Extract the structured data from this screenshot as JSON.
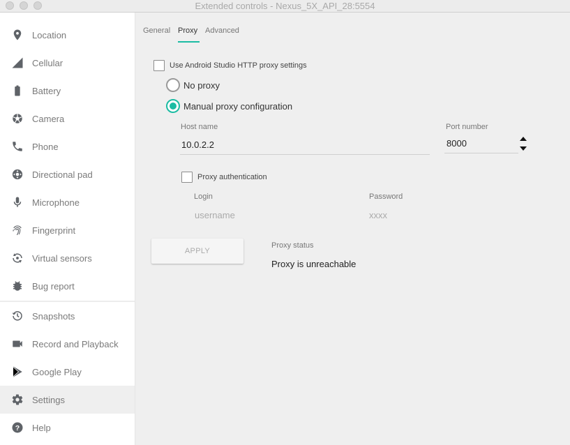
{
  "window": {
    "title": "Extended controls - Nexus_5X_API_28:5554"
  },
  "sidebar": {
    "items": [
      {
        "label": "Location",
        "icon": "location-pin-icon"
      },
      {
        "label": "Cellular",
        "icon": "cellular-signal-icon"
      },
      {
        "label": "Battery",
        "icon": "battery-icon"
      },
      {
        "label": "Camera",
        "icon": "camera-aperture-icon"
      },
      {
        "label": "Phone",
        "icon": "phone-icon"
      },
      {
        "label": "Directional pad",
        "icon": "dpad-icon"
      },
      {
        "label": "Microphone",
        "icon": "microphone-icon"
      },
      {
        "label": "Fingerprint",
        "icon": "fingerprint-icon"
      },
      {
        "label": "Virtual sensors",
        "icon": "virtual-sensors-icon"
      },
      {
        "label": "Bug report",
        "icon": "bug-icon"
      },
      {
        "label": "Snapshots",
        "icon": "snapshot-history-icon"
      },
      {
        "label": "Record and Playback",
        "icon": "video-camera-icon"
      },
      {
        "label": "Google Play",
        "icon": "play-store-icon"
      },
      {
        "label": "Settings",
        "icon": "gear-icon",
        "active": true
      },
      {
        "label": "Help",
        "icon": "help-icon"
      }
    ]
  },
  "tabs": {
    "general": "General",
    "proxy": "Proxy",
    "advanced": "Advanced",
    "active": "Proxy"
  },
  "proxy": {
    "use_studio_label": "Use Android Studio HTTP proxy settings",
    "use_studio_checked": false,
    "no_proxy_label": "No proxy",
    "manual_label": "Manual proxy configuration",
    "selected": "manual",
    "host_caption": "Host name",
    "host_value": "10.0.2.2",
    "port_caption": "Port number",
    "port_value": "8000",
    "auth_label": "Proxy authentication",
    "auth_checked": false,
    "login_caption": "Login",
    "login_placeholder": "username",
    "password_caption": "Password",
    "password_placeholder": "xxxx",
    "apply_label": "APPLY",
    "status_caption": "Proxy status",
    "status_value": "Proxy is unreachable"
  },
  "colors": {
    "accent": "#1bbca3",
    "icon": "#5f6368"
  }
}
